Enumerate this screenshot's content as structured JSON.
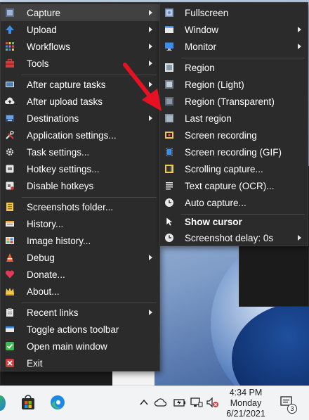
{
  "main_menu": {
    "items": [
      {
        "label": "Capture",
        "icon": "capture-icon",
        "submenu": true,
        "highlight": true
      },
      {
        "label": "Upload",
        "icon": "upload-icon",
        "submenu": true
      },
      {
        "label": "Workflows",
        "icon": "workflows-icon",
        "submenu": true
      },
      {
        "label": "Tools",
        "icon": "tools-icon",
        "submenu": true
      },
      {
        "label": "After capture tasks",
        "icon": "after-capture-icon",
        "submenu": true
      },
      {
        "label": "After upload tasks",
        "icon": "after-upload-icon",
        "submenu": false
      },
      {
        "label": "Destinations",
        "icon": "destinations-icon",
        "submenu": true
      },
      {
        "label": "Application settings...",
        "icon": "app-settings-icon",
        "submenu": false
      },
      {
        "label": "Task settings...",
        "icon": "gear-icon",
        "submenu": false
      },
      {
        "label": "Hotkey settings...",
        "icon": "hotkey-icon",
        "submenu": false
      },
      {
        "label": "Disable hotkeys",
        "icon": "disable-hotkeys-icon",
        "submenu": false
      },
      {
        "label": "Screenshots folder...",
        "icon": "folder-icon",
        "submenu": false
      },
      {
        "label": "History...",
        "icon": "history-icon",
        "submenu": false
      },
      {
        "label": "Image history...",
        "icon": "image-history-icon",
        "submenu": false
      },
      {
        "label": "Debug",
        "icon": "debug-icon",
        "submenu": true
      },
      {
        "label": "Donate...",
        "icon": "heart-icon",
        "submenu": false
      },
      {
        "label": "About...",
        "icon": "crown-icon",
        "submenu": false
      },
      {
        "label": "Recent links",
        "icon": "clipboard-icon",
        "submenu": true
      },
      {
        "label": "Toggle actions toolbar",
        "icon": "toolbar-icon",
        "submenu": false
      },
      {
        "label": "Open main window",
        "icon": "check-icon",
        "submenu": false
      },
      {
        "label": "Exit",
        "icon": "exit-icon",
        "submenu": false
      }
    ]
  },
  "capture_menu": {
    "items": [
      {
        "label": "Fullscreen",
        "icon": "fullscreen-icon",
        "submenu": false
      },
      {
        "label": "Window",
        "icon": "window-icon",
        "submenu": true
      },
      {
        "label": "Monitor",
        "icon": "monitor-icon",
        "submenu": true
      },
      {
        "label": "Region",
        "icon": "region-icon",
        "submenu": false
      },
      {
        "label": "Region (Light)",
        "icon": "region-light-icon",
        "submenu": false
      },
      {
        "label": "Region (Transparent)",
        "icon": "region-transparent-icon",
        "submenu": false
      },
      {
        "label": "Last region",
        "icon": "last-region-icon",
        "submenu": false
      },
      {
        "label": "Screen recording",
        "icon": "screen-recording-icon",
        "submenu": false
      },
      {
        "label": "Screen recording (GIF)",
        "icon": "film-icon",
        "submenu": false
      },
      {
        "label": "Scrolling capture...",
        "icon": "scrolling-capture-icon",
        "submenu": false
      },
      {
        "label": "Text capture (OCR)...",
        "icon": "text-capture-icon",
        "submenu": false
      },
      {
        "label": "Auto capture...",
        "icon": "clock-icon",
        "submenu": false
      },
      {
        "label": "Show cursor",
        "icon": "cursor-icon",
        "submenu": false,
        "bold": true
      },
      {
        "label": "Screenshot delay: 0s",
        "icon": "clock-icon",
        "submenu": true
      }
    ]
  },
  "taskbar": {
    "time": "4:34 PM",
    "day": "Monday",
    "date": "6/21/2021",
    "notification_count": "3"
  },
  "colors": {
    "menu_bg": "#2b2b2b",
    "menu_highlight": "#414141",
    "text": "#ffffff",
    "arrow_annotation": "#e81123"
  }
}
